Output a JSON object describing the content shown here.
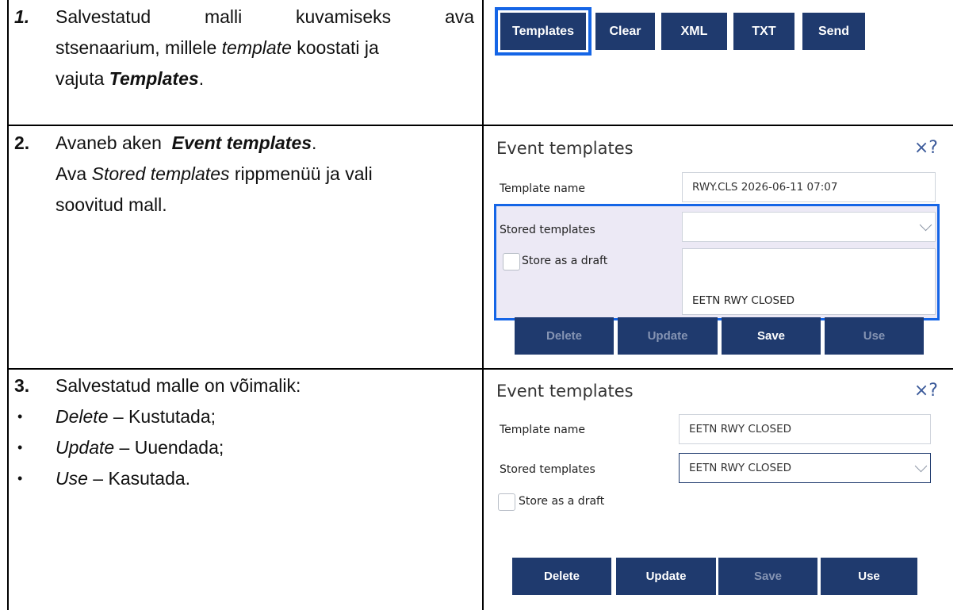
{
  "row1": {
    "num": "1.",
    "line1_words": [
      "Salvestatud",
      "malli",
      "kuvamiseks",
      "ava"
    ],
    "line2_pre": "stsenaarium, millele ",
    "line2_em": "template",
    "line2_post": " koostati ja",
    "line3_pre": "vajuta ",
    "line3_em": "Templates",
    "line3_post": "."
  },
  "toolbar": {
    "templates": "Templates",
    "clear": "Clear",
    "xml": "XML",
    "txt": "TXT",
    "send": "Send"
  },
  "row2": {
    "num": "2.",
    "line1_pre": "Avaneb aken  ",
    "line1_em": "Event templates",
    "line1_post": ".",
    "line2_pre": "Ava ",
    "line2_em": "Stored templates",
    "line2_post": " rippmenüü ja vali",
    "line3": "soovitud mall."
  },
  "row3": {
    "num": "3.",
    "line1": "Salvestatud malle on võimalik:",
    "bullet": "•",
    "items": [
      {
        "term": "Delete",
        "desc": " – Kustutada;"
      },
      {
        "term": "Update",
        "desc": " – Uuendada;"
      },
      {
        "term": "Use",
        "desc": " – Kasutada."
      }
    ]
  },
  "panel1": {
    "title": "Event templates",
    "close": "×?",
    "template_name_label": "Template name",
    "template_name_value": "RWY.CLS 2026-06-11 07:07",
    "stored_label": "Stored templates",
    "stored_value": "",
    "draft_label": "Store as a draft",
    "dropdown_option": "EETN RWY CLOSED",
    "buttons": {
      "delete": "Delete",
      "update": "Update",
      "save": "Save",
      "use": "Use"
    }
  },
  "panel2": {
    "title": "Event templates",
    "close": "×?",
    "template_name_label": "Template name",
    "template_name_value": "EETN RWY CLOSED",
    "stored_label": "Stored templates",
    "stored_value": "EETN RWY CLOSED",
    "draft_label": "Store as a draft",
    "buttons": {
      "delete": "Delete",
      "update": "Update",
      "save": "Save",
      "use": "Use"
    }
  },
  "colors": {
    "button_bg": "#1f3a6e",
    "highlight_border": "#1565e6",
    "highlight_fill": "#ece9f5",
    "disabled_text": "#8594b3"
  }
}
